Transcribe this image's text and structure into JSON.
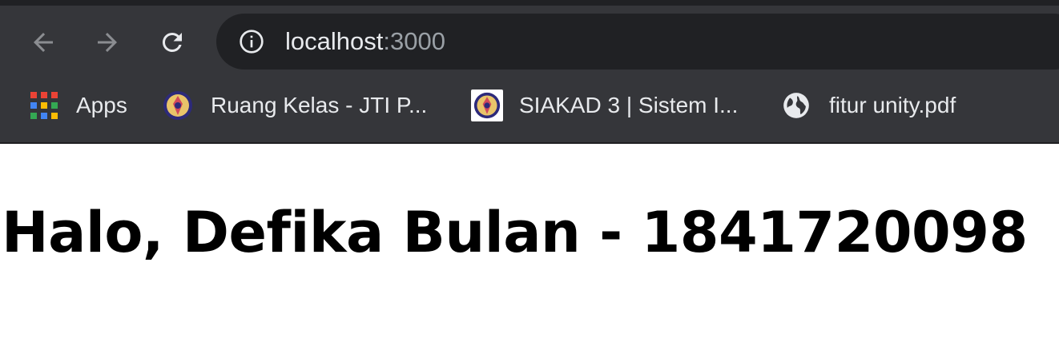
{
  "browser": {
    "toolbar_color": "#35363a",
    "omnibox_color": "#202124",
    "nav": {
      "back_icon": "arrow-left-icon",
      "forward_icon": "arrow-right-icon",
      "reload_icon": "reload-icon"
    },
    "address_bar": {
      "icon": "info-icon",
      "host": "localhost",
      "port": ":3000"
    },
    "bookmarks": [
      {
        "label": "Apps",
        "icon": "apps-grid-icon"
      },
      {
        "label": "Ruang Kelas - JTI P...",
        "icon": "polinema-logo-icon"
      },
      {
        "label": "SIAKAD 3 | Sistem I...",
        "icon": "polinema-logo-icon"
      },
      {
        "label": "fitur unity.pdf",
        "icon": "globe-icon"
      }
    ]
  },
  "page": {
    "heading": "Halo, Defika Bulan - 1841720098"
  }
}
